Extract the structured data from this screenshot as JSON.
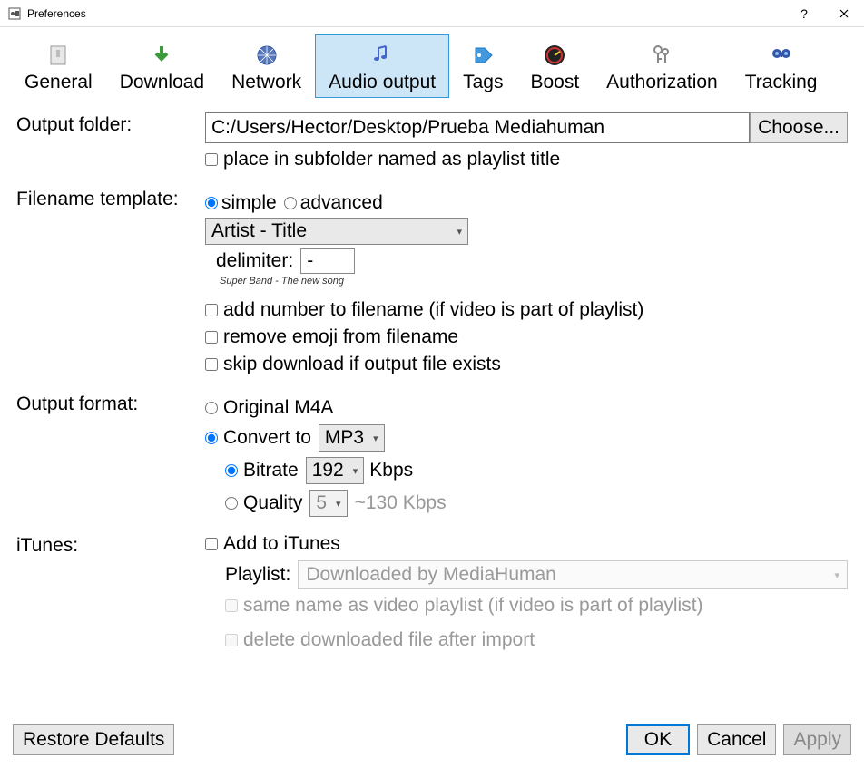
{
  "window": {
    "title": "Preferences"
  },
  "tabs": [
    {
      "label": "General"
    },
    {
      "label": "Download"
    },
    {
      "label": "Network"
    },
    {
      "label": "Audio output"
    },
    {
      "label": "Tags"
    },
    {
      "label": "Boost"
    },
    {
      "label": "Authorization"
    },
    {
      "label": "Tracking"
    }
  ],
  "labels": {
    "output_folder": "Output folder:",
    "filename_template": "Filename template:",
    "output_format": "Output format:",
    "itunes": "iTunes:",
    "delimiter": "delimiter:",
    "playlist": "Playlist:"
  },
  "output_folder": {
    "path": "C:/Users/Hector/Desktop/Prueba Mediahuman",
    "choose_btn": "Choose...",
    "subfolder_cb": "place in subfolder named as playlist title"
  },
  "filename_template": {
    "simple": "simple",
    "advanced": "advanced",
    "preset": "Artist - Title",
    "delimiter_value": "-",
    "example": "Super Band - The new song",
    "add_number_cb": "add number to filename (if video is part of playlist)",
    "remove_emoji_cb": "remove emoji from filename",
    "skip_exists_cb": "skip download if output file exists"
  },
  "output_format": {
    "original": "Original M4A",
    "convert_to": "Convert to",
    "format": "MP3",
    "bitrate_label": "Bitrate",
    "bitrate_value": "192",
    "bitrate_unit": "Kbps",
    "quality_label": "Quality",
    "quality_value": "5",
    "quality_est": "~130 Kbps"
  },
  "itunes": {
    "add_cb": "Add to iTunes",
    "playlist_value": "Downloaded by MediaHuman",
    "same_name_cb": "same name as video playlist (if video is part of playlist)",
    "delete_after_cb": "delete downloaded file after import"
  },
  "footer": {
    "restore": "Restore Defaults",
    "ok": "OK",
    "cancel": "Cancel",
    "apply": "Apply"
  }
}
